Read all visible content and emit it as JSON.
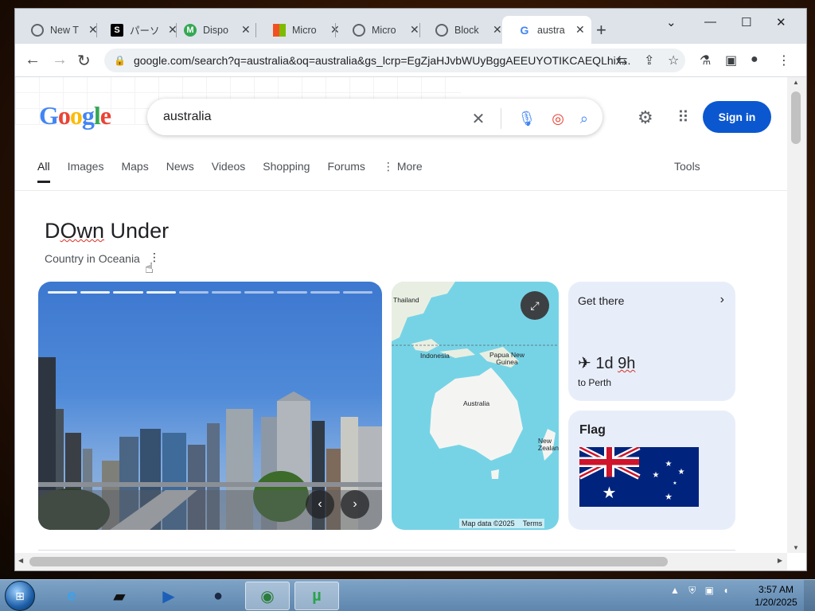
{
  "browser": {
    "tabs": [
      {
        "title": "New T",
        "icon": "chrome-icon",
        "color": "#5f6368"
      },
      {
        "title": "パーソ",
        "icon": "s-icon",
        "color": "#000000"
      },
      {
        "title": "Dispo",
        "icon": "m-icon",
        "color": "#34a853"
      },
      {
        "title": "Micro",
        "icon": "microsoft-icon",
        "color": "#f25022"
      },
      {
        "title": "Micro",
        "icon": "globe-icon",
        "color": "#5f6368"
      },
      {
        "title": "Block",
        "icon": "globe-icon",
        "color": "#5f6368"
      },
      {
        "title": "austra",
        "icon": "google-icon",
        "color": "#4285f4",
        "active": true
      }
    ],
    "url": "google.com/search?q=australia&oq=australia&gs_lcrp=EgZjaHJvbWUyBggAEEUYOTIKCAEQLhix..."
  },
  "search": {
    "logo_text": "Google",
    "query": "australia",
    "signin_label": "Sign in",
    "filters": [
      "All",
      "Images",
      "Maps",
      "News",
      "Videos",
      "Shopping",
      "Forums",
      "More"
    ],
    "active_filter": "All",
    "tools_label": "Tools"
  },
  "knowledge_panel": {
    "title_prefix": "D",
    "title_squiggle": "Own",
    "title_suffix": " Under",
    "subtitle": "Country in Oceania",
    "map": {
      "labels": [
        "Thailand",
        "Indonesia",
        "Papua New Guinea",
        "Australia",
        "New Zealand"
      ],
      "footer_data": "Map data ©2025",
      "footer_terms": "Terms"
    },
    "get_there": {
      "header": "Get there",
      "duration_prefix": "1d",
      "duration_squiggle": "9h",
      "destination": "to Perth"
    },
    "flag": {
      "header": "Flag"
    }
  },
  "taskbar": {
    "time": "3:57 AM",
    "date": "1/20/2025"
  },
  "colors": {
    "accent": "#0b57d0",
    "flag_blue": "#00247d",
    "flag_red": "#cf142b"
  }
}
